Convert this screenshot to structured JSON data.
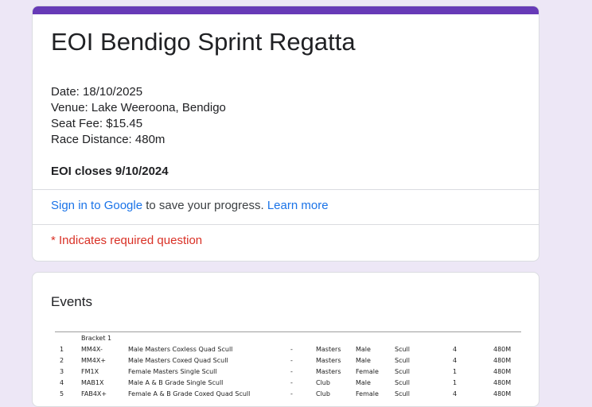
{
  "form": {
    "title": "EOI Bendigo Sprint Regatta",
    "description_lines": [
      "Date: 18/10/2025",
      "Venue: Lake Weeroona, Bendigo",
      "Seat Fee: $15.45",
      "Race Distance: 480m"
    ],
    "closing_note": "EOI closes 9/10/2024",
    "accent_color": "#673ab7"
  },
  "signin": {
    "link_label": "Sign in to Google",
    "middle_text": " to save your progress. ",
    "learn_more_label": "Learn more"
  },
  "required_notice": "* Indicates required question",
  "events": {
    "title": "Events",
    "bracket_label": "Bracket 1",
    "rows": [
      {
        "num": "1",
        "code": "MM4X-",
        "name": "Male Masters Coxless Quad Scull",
        "dash": "-",
        "category": "Masters",
        "gender": "Male",
        "boat": "Scull",
        "seats": "4",
        "distance": "480M"
      },
      {
        "num": "2",
        "code": "MM4X+",
        "name": "Male Masters Coxed Quad Scull",
        "dash": "-",
        "category": "Masters",
        "gender": "Male",
        "boat": "Scull",
        "seats": "4",
        "distance": "480M"
      },
      {
        "num": "3",
        "code": "FM1X",
        "name": "Female Masters Single Scull",
        "dash": "-",
        "category": "Masters",
        "gender": "Female",
        "boat": "Scull",
        "seats": "1",
        "distance": "480M"
      },
      {
        "num": "4",
        "code": "MAB1X",
        "name": "Male A & B Grade Single Scull",
        "dash": "-",
        "category": "Club",
        "gender": "Male",
        "boat": "Scull",
        "seats": "1",
        "distance": "480M"
      },
      {
        "num": "5",
        "code": "FAB4X+",
        "name": "Female A & B Grade Coxed Quad Scull",
        "dash": "-",
        "category": "Club",
        "gender": "Female",
        "boat": "Scull",
        "seats": "4",
        "distance": "480M"
      }
    ]
  }
}
